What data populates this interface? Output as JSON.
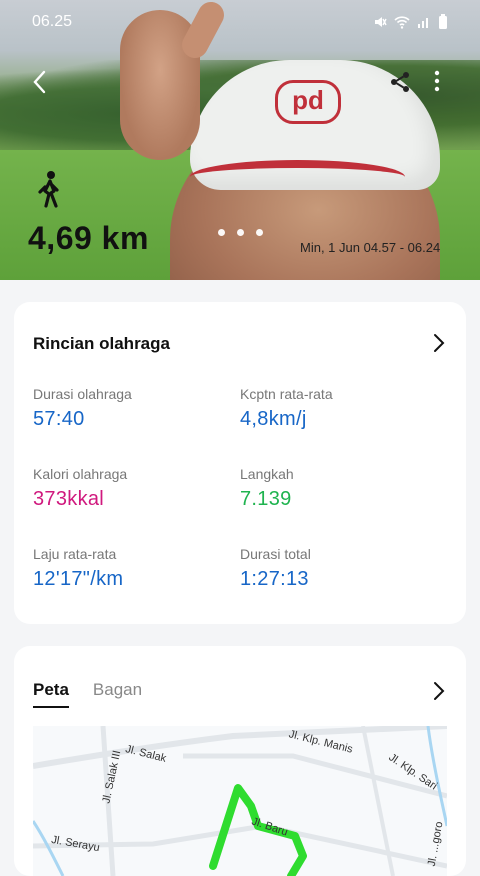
{
  "status_bar": {
    "time": "06.25",
    "icons": [
      "mute-icon",
      "wifi-icon",
      "signal-icon",
      "battery-icon"
    ]
  },
  "hero": {
    "distance": "4,69 km",
    "date_range": "Min, 1 Jun 04.57 - 06.24",
    "page_dots": 3
  },
  "details": {
    "title": "Rincian olahraga",
    "metrics": [
      {
        "label": "Durasi olahraga",
        "value": "57:40",
        "color": "#1766c7"
      },
      {
        "label": "Kcptn rata-rata",
        "value": "4,8km/j",
        "color": "#1766c7"
      },
      {
        "label": "Kalori olahraga",
        "value": "373kkal",
        "color": "#d0197e"
      },
      {
        "label": "Langkah",
        "value": "7.139",
        "color": "#1fb34f"
      },
      {
        "label": "Laju rata-rata",
        "value": "12'17\"/km",
        "color": "#1766c7"
      },
      {
        "label": "Durasi total",
        "value": "1:27:13",
        "color": "#1766c7"
      }
    ]
  },
  "map_section": {
    "tabs": [
      {
        "label": "Peta",
        "active": true
      },
      {
        "label": "Bagan",
        "active": false
      }
    ],
    "roads": [
      "Jl. Klp. Manis",
      "Jl. Salak",
      "Jl. Salak III",
      "Jl. Klp. Sari",
      "Jl. Baru",
      "Jl. Serayu",
      "Jl. ...goro"
    ]
  }
}
